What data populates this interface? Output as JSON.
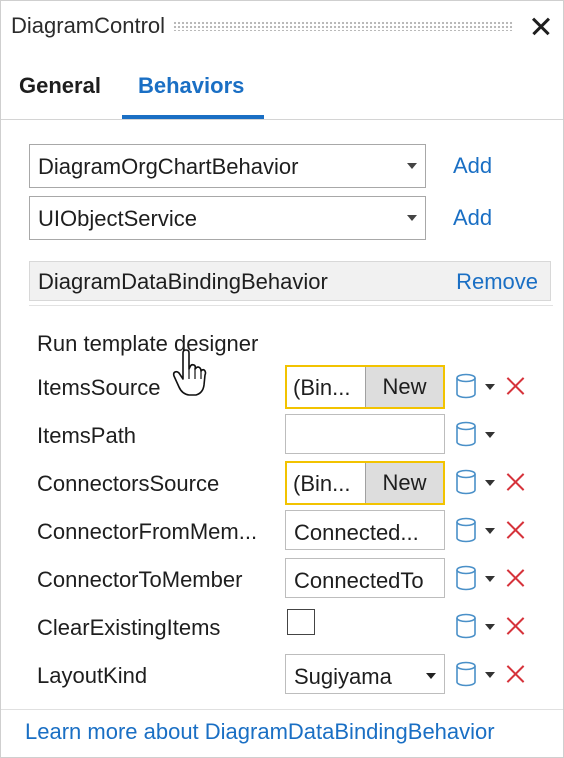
{
  "window": {
    "title": "DiagramControl"
  },
  "tabs": [
    {
      "label": "General"
    },
    {
      "label": "Behaviors"
    }
  ],
  "behavior_pickers": [
    {
      "value": "DiagramOrgChartBehavior",
      "action": "Add"
    },
    {
      "value": "UIObjectService",
      "action": "Add"
    }
  ],
  "behavior_item": {
    "name": "DiagramDataBindingBehavior",
    "action": "Remove"
  },
  "run_designer": "Run template designer",
  "properties": [
    {
      "label": "ItemsSource",
      "value": "(Bin...",
      "button": "New"
    },
    {
      "label": "ItemsPath",
      "value": ""
    },
    {
      "label": "ConnectorsSource",
      "value": "(Bin...",
      "button": "New"
    },
    {
      "label": "ConnectorFromMem...",
      "value": "Connected..."
    },
    {
      "label": "ConnectorToMember",
      "value": "ConnectedTo"
    },
    {
      "label": "ClearExistingItems",
      "checked": false
    },
    {
      "label": "LayoutKind",
      "value": "Sugiyama"
    }
  ],
  "learn_more": "Learn more about DiagramDataBindingBehavior",
  "icons": {
    "binding": "database-icon",
    "dropdown": "chevron-down-icon",
    "reset": "close-icon",
    "pointer": "hand-cursor-icon"
  },
  "colors": {
    "accent": "#1a6fc4",
    "binding_highlight": "#f2c300",
    "reset_red": "#d6333b"
  }
}
